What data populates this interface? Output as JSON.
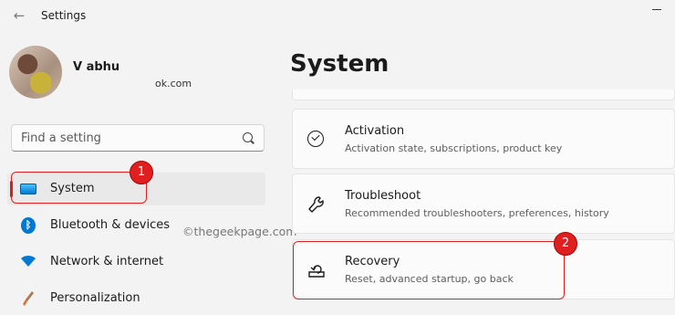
{
  "window": {
    "title": "Settings"
  },
  "user": {
    "name": "V                    abhu",
    "email": "ok.com"
  },
  "search": {
    "placeholder": "Find a setting"
  },
  "nav": {
    "items": [
      {
        "label": "System",
        "icon": "display-icon",
        "selected": true
      },
      {
        "label": "Bluetooth & devices",
        "icon": "bluetooth-icon"
      },
      {
        "label": "Network & internet",
        "icon": "wifi-icon"
      },
      {
        "label": "Personalization",
        "icon": "brush-icon"
      }
    ]
  },
  "watermark": "©thegeekpage.com",
  "main": {
    "title": "System",
    "cards": [
      {
        "title": "Activation",
        "description": "Activation state, subscriptions, product key",
        "icon": "check-circle-icon"
      },
      {
        "title": "Troubleshoot",
        "description": "Recommended troubleshooters, preferences, history",
        "icon": "wrench-icon"
      },
      {
        "title": "Recovery",
        "description": "Reset, advanced startup, go back",
        "icon": "recovery-icon"
      }
    ]
  },
  "callouts": [
    "1",
    "2"
  ],
  "colors": {
    "accent": "#0067c0",
    "callout": "#e02020",
    "background": "#f3f3f3",
    "card": "#fbfbfb"
  }
}
